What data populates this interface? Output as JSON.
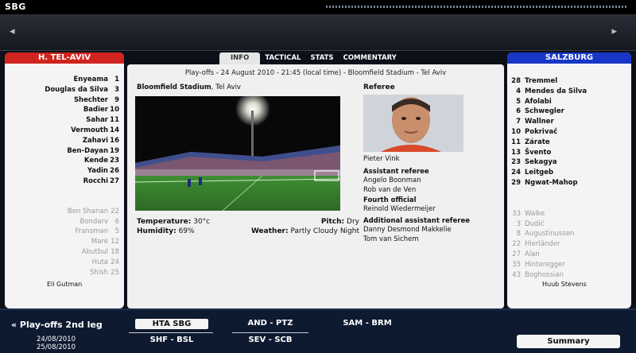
{
  "top": {
    "club_abbr": "SBG"
  },
  "nav": {
    "prev": "◂",
    "next": "▸"
  },
  "home": {
    "name": "H. TEL-AVIV",
    "starters": [
      {
        "name": "Enyeama",
        "no": "1"
      },
      {
        "name": "Douglas da Silva",
        "no": "3"
      },
      {
        "name": "Shechter",
        "no": "9"
      },
      {
        "name": "Badier",
        "no": "10"
      },
      {
        "name": "Sahar",
        "no": "11"
      },
      {
        "name": "Vermouth",
        "no": "14"
      },
      {
        "name": "Zahavi",
        "no": "16"
      },
      {
        "name": "Ben-Dayan",
        "no": "19"
      },
      {
        "name": "Kende",
        "no": "23"
      },
      {
        "name": "Yadin",
        "no": "26"
      },
      {
        "name": "Rocchi",
        "no": "27"
      }
    ],
    "subs": [
      {
        "name": "Ben Shanan",
        "no": "22"
      },
      {
        "name": "Bondarv",
        "no": "6"
      },
      {
        "name": "Fransman",
        "no": "5"
      },
      {
        "name": "Mare",
        "no": "12"
      },
      {
        "name": "Abutbul",
        "no": "18"
      },
      {
        "name": "Huta",
        "no": "24"
      },
      {
        "name": "Shish",
        "no": "25"
      }
    ],
    "manager": "Eli Gutman"
  },
  "away": {
    "name": "SALZBURG",
    "starters": [
      {
        "no": "28",
        "name": "Tremmel"
      },
      {
        "no": "4",
        "name": "Mendes da Silva"
      },
      {
        "no": "5",
        "name": "Afolabi"
      },
      {
        "no": "6",
        "name": "Schwegler"
      },
      {
        "no": "7",
        "name": "Wallner"
      },
      {
        "no": "10",
        "name": "Pokrivač"
      },
      {
        "no": "11",
        "name": "Zárate"
      },
      {
        "no": "13",
        "name": "Švento"
      },
      {
        "no": "23",
        "name": "Sekagya"
      },
      {
        "no": "24",
        "name": "Leitgeb"
      },
      {
        "no": "29",
        "name": "Ngwat-Mahop"
      }
    ],
    "subs": [
      {
        "no": "33",
        "name": "Walke"
      },
      {
        "no": "3",
        "name": "Dudić"
      },
      {
        "no": "8",
        "name": "Augustinussen"
      },
      {
        "no": "22",
        "name": "Hierländer"
      },
      {
        "no": "27",
        "name": "Alan"
      },
      {
        "no": "35",
        "name": "Hinteregger"
      },
      {
        "no": "43",
        "name": "Boghossian"
      }
    ],
    "manager": "Huub Stevens"
  },
  "tabs": [
    "INFO",
    "TACTICAL",
    "STATS",
    "COMMENTARY"
  ],
  "info": {
    "subheader": "Play-offs - 24 August 2010 - 21:45 (local time) - Bloomfield Stadium - Tel Aviv",
    "stadium_name": "Bloomfield Stadium",
    "stadium_city": ", Tel Aviv",
    "temperature_label": "Temperature:",
    "temperature": "30°c",
    "pitch_label": "Pitch:",
    "pitch": "Dry",
    "humidity_label": "Humidity:",
    "humidity": "69%",
    "weather_label": "Weather:",
    "weather": "Partly Cloudy Night",
    "referee_label": "Referee",
    "referee": "Pieter Vink",
    "assistant_label": "Assistant referee",
    "assistants": [
      "Angelo Boonman",
      "Rob van de Ven"
    ],
    "fourth_label": "Fourth official",
    "fourth": "Reinold Wiedermeijer",
    "additional_label": "Additional assistant referee",
    "additional": [
      "Danny Desmond Makkelie",
      "Tom van Sichem"
    ]
  },
  "bottom": {
    "round": "« Play-offs 2nd leg",
    "dates": [
      "24/08/2010",
      "25/08/2010"
    ],
    "fixtures": [
      "HTA SBG",
      "SHF - BSL",
      "AND - PTZ",
      "SEV - SCB",
      "SAM - BRM"
    ],
    "summary": "Summary"
  }
}
